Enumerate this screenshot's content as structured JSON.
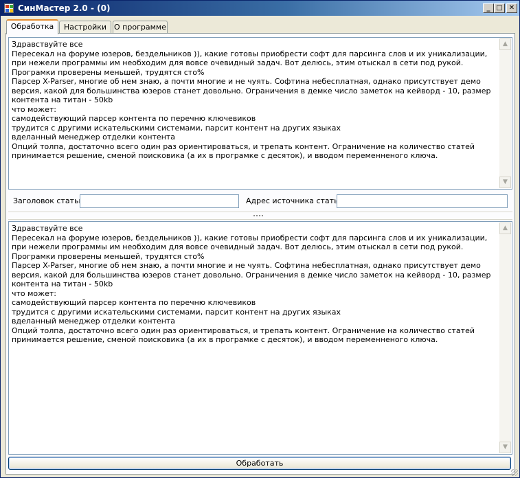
{
  "window": {
    "title": "СинМастер 2.0 -  (0)",
    "controls": {
      "minimize": "_",
      "maximize": "□",
      "close": "✕"
    }
  },
  "tabs": [
    {
      "label": "Обработка",
      "active": true
    },
    {
      "label": "Настройки",
      "active": false
    },
    {
      "label": "О программе",
      "active": false
    }
  ],
  "source_text": "Здравствуйте все\nПересекал на форуме юзеров, бездельников )), какие готовы приобрести софт для парсинга слов и их уникализации, при нежели программы им необходим для вовсе очевидный задач. Вот делюсь, этим отыскал в сети под рукой. Програмки проверены меньшей, трудятся сто%\nПарсер X-Parser, многие об нем знаю, а почти многие и не чуять. Софтина небесплатная, однако присутствует демо версия, какой для большинства юзеров станет довольно. Ограничения в демке число заметок на кейворд - 10, размер контента на титан - 50kb\nчто может:\nсамодействующий парсер контента по перечню ключевиков\nтрудится с другими искательскими системами, парсит контент на других языках\nвделанный менеджер отделки контента\nОпций толпа, достаточно всего один раз ориентироваться, и трепать контент. Ограничение на количество статей принимается решение, сменой поисковика (а их в програмке с десяток), и вводом переменненого ключа.",
  "fields": {
    "title_label": "Заголовок статьи",
    "title_value": "",
    "source_label": "Адрес источника статьи",
    "source_value": ""
  },
  "result_text": "Здравствуйте все\nПересекал на форуме юзеров, бездельников )), какие готовы приобрести софт для парсинга слов и их уникализации, при нежели программы им необходим для вовсе очевидный задач. Вот делюсь, этим отыскал в сети под рукой. Програмки проверены меньшей, трудятся сто%\nПарсер X-Parser, многие об нем знаю, а почти многие и не чуять. Софтина небесплатная, однако присутствует демо версия, какой для большинства юзеров станет довольно. Ограничения в демке число заметок на кейворд - 10, размер контента на титан - 50kb\nчто может:\nсамодействующий парсер контента по перечню ключевиков\nтрудится с другими искательскими системами, парсит контент на других языках\nвделанный менеджер отделки контента\nОпций толпа, достаточно всего один раз ориентироваться, и трепать контент. Ограничение на количество статей принимается решение, сменой поисковика (а их в програмке с десяток), и вводом переменненого ключа.",
  "actions": {
    "process_label": "Обработать"
  },
  "scroll_glyphs": {
    "up": "▲",
    "down": "▼"
  },
  "colors": {
    "titlebar_start": "#0a246a",
    "titlebar_end": "#a6caf0",
    "active_tab_accent": "#e68b2c"
  }
}
